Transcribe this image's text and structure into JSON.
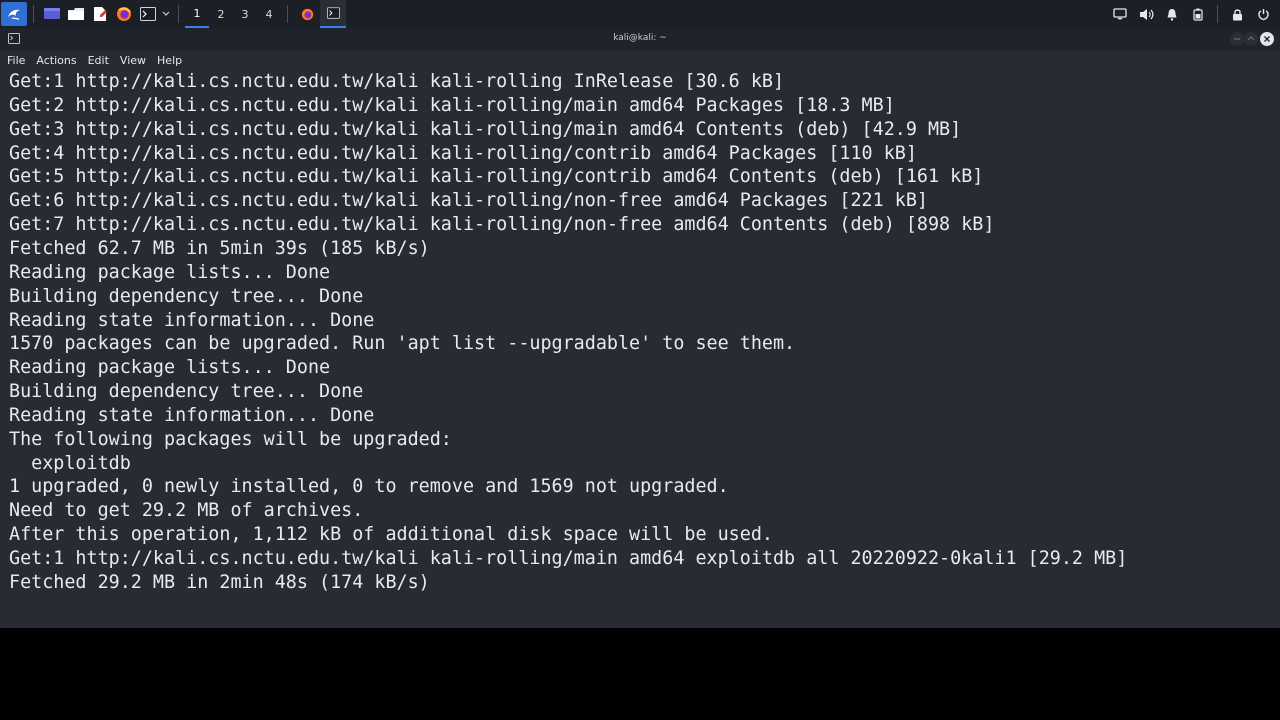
{
  "taskbar": {
    "workspaces": [
      "1",
      "2",
      "3",
      "4"
    ],
    "launchers": [
      "app-menu-icon",
      "desktop-icon",
      "file-manager-icon",
      "text-editor-icon",
      "firefox-icon",
      "terminal-icon"
    ],
    "tray": [
      "display-icon",
      "volume-icon",
      "notification-bell-icon",
      "battery-icon",
      "lock-icon",
      "power-icon"
    ]
  },
  "window": {
    "title": "kali@kali: ~",
    "menu": [
      "File",
      "Actions",
      "Edit",
      "View",
      "Help"
    ]
  },
  "terminal": {
    "lines": [
      "Get:1 http://kali.cs.nctu.edu.tw/kali kali-rolling InRelease [30.6 kB]",
      "Get:2 http://kali.cs.nctu.edu.tw/kali kali-rolling/main amd64 Packages [18.3 MB]",
      "Get:3 http://kali.cs.nctu.edu.tw/kali kali-rolling/main amd64 Contents (deb) [42.9 MB]",
      "Get:4 http://kali.cs.nctu.edu.tw/kali kali-rolling/contrib amd64 Packages [110 kB]",
      "Get:5 http://kali.cs.nctu.edu.tw/kali kali-rolling/contrib amd64 Contents (deb) [161 kB]",
      "Get:6 http://kali.cs.nctu.edu.tw/kali kali-rolling/non-free amd64 Packages [221 kB]",
      "Get:7 http://kali.cs.nctu.edu.tw/kali kali-rolling/non-free amd64 Contents (deb) [898 kB]",
      "Fetched 62.7 MB in 5min 39s (185 kB/s)",
      "Reading package lists... Done",
      "Building dependency tree... Done",
      "Reading state information... Done",
      "1570 packages can be upgraded. Run 'apt list --upgradable' to see them.",
      "Reading package lists... Done",
      "Building dependency tree... Done",
      "Reading state information... Done",
      "The following packages will be upgraded:",
      "  exploitdb",
      "1 upgraded, 0 newly installed, 0 to remove and 1569 not upgraded.",
      "Need to get 29.2 MB of archives.",
      "After this operation, 1,112 kB of additional disk space will be used.",
      "Get:1 http://kali.cs.nctu.edu.tw/kali kali-rolling/main amd64 exploitdb all 20220922-0kali1 [29.2 MB]",
      "Fetched 29.2 MB in 2min 48s (174 kB/s)"
    ]
  },
  "colors": {
    "panel": "#1c1f26",
    "terminal_bg": "#272b34",
    "terminal_fg": "#e8eaed",
    "accent": "#3d7ee8",
    "kali_blue": "#2f6fd6"
  }
}
